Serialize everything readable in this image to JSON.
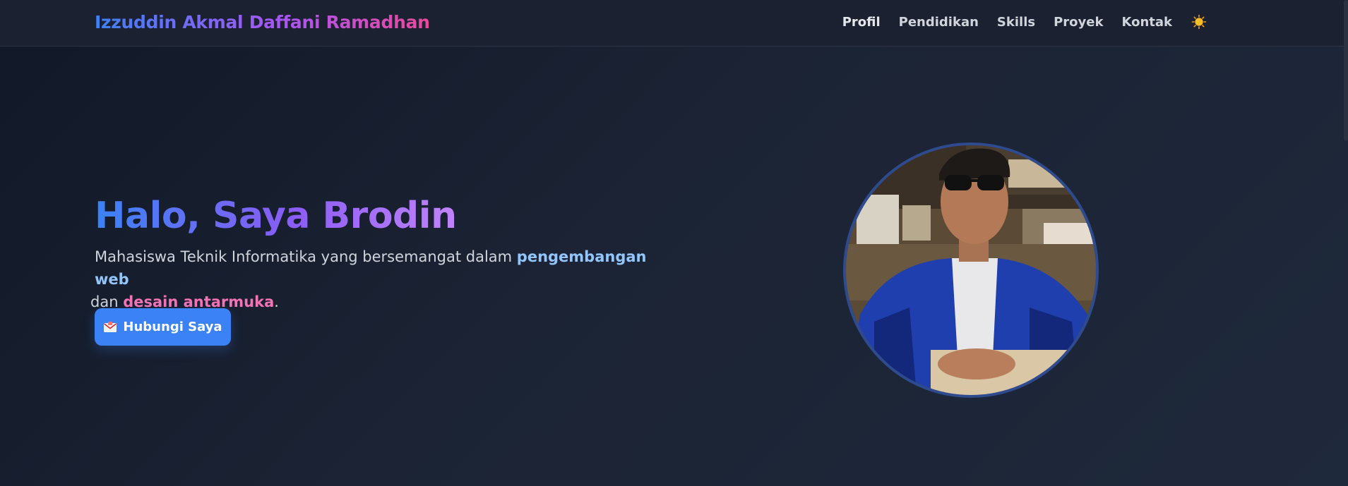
{
  "header": {
    "brand": "Izzuddin Akmal Daffani Ramadhan",
    "nav": [
      {
        "label": "Profil",
        "active": true
      },
      {
        "label": "Pendidikan"
      },
      {
        "label": "Skills"
      },
      {
        "label": "Proyek"
      },
      {
        "label": "Kontak"
      }
    ],
    "theme_toggle_icon": "sun-icon"
  },
  "hero": {
    "title": "Halo, Saya Brodin",
    "desc_part1": "Mahasiswa Teknik Informatika yang bersemangat dalam ",
    "desc_highlight1": "pengembangan web",
    "desc_part2": " dan ",
    "desc_highlight2": "desain antarmuka",
    "desc_part3": ".",
    "cta_icon": "envelope-icon",
    "cta_label": "Hubungi Saya",
    "photo_icon": "profile-photo"
  },
  "colors": {
    "accent": "#3b82f6",
    "purple": "#a855f7",
    "pink": "#ec4899",
    "background": "#1b2130"
  }
}
